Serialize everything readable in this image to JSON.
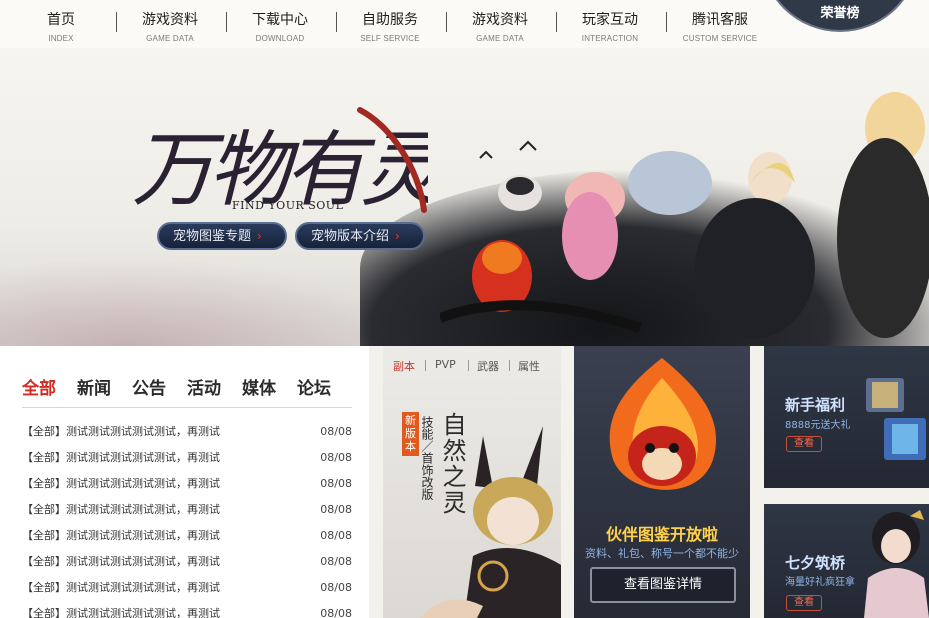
{
  "nav": {
    "items": [
      {
        "cn": "首页",
        "en": "INDEX"
      },
      {
        "cn": "游戏资料",
        "en": "GAME DATA"
      },
      {
        "cn": "下载中心",
        "en": "DOWNLOAD"
      },
      {
        "cn": "自助服务",
        "en": "SELF SERVICE"
      },
      {
        "cn": "游戏资料",
        "en": "GAME DATA"
      },
      {
        "cn": "玩家互动",
        "en": "INTERACTION"
      },
      {
        "cn": "腾讯客服",
        "en": "CUSTOM SERVICE"
      }
    ],
    "honor_label": "荣誉榜"
  },
  "hero": {
    "title": "万物有灵",
    "subtitle": "FIND YOUR SOUL",
    "btn_pet_album": "宠物图鉴专题",
    "btn_pet_version": "宠物版本介绍",
    "arrow": "›"
  },
  "news": {
    "tabs": [
      "全部",
      "新闻",
      "公告",
      "活动",
      "媒体",
      "论坛"
    ],
    "items": [
      {
        "title": "【全部】测试测试测试测试测试，再测试",
        "date": "08/08"
      },
      {
        "title": "【全部】测试测试测试测试测试，再测试",
        "date": "08/08"
      },
      {
        "title": "【全部】测试测试测试测试测试，再测试",
        "date": "08/08"
      },
      {
        "title": "【全部】测试测试测试测试测试，再测试",
        "date": "08/08"
      },
      {
        "title": "【全部】测试测试测试测试测试，再测试",
        "date": "08/08"
      },
      {
        "title": "【全部】测试测试测试测试测试，再测试",
        "date": "08/08"
      },
      {
        "title": "【全部】测试测试测试测试测试，再测试",
        "date": "08/08"
      },
      {
        "title": "【全部】测试测试测试测试测试，再测试",
        "date": "08/08"
      }
    ]
  },
  "promo_version": {
    "tabs": [
      "副本",
      "PVP",
      "武器",
      "属性"
    ],
    "badge": "新版本",
    "line1": "技能／首饰改版",
    "title": "自然之灵"
  },
  "promo_pet": {
    "title": "伙伴图鉴开放啦",
    "subtitle": "资料、礼包、称号一个都不能少",
    "button": "查看图鉴详情"
  },
  "cards": [
    {
      "title": "新手福利",
      "subtitle": "8888元送大礼",
      "button": "查看"
    },
    {
      "title": "七夕筑桥",
      "subtitle": "海量好礼疯狂拿",
      "button": "查看"
    }
  ]
}
